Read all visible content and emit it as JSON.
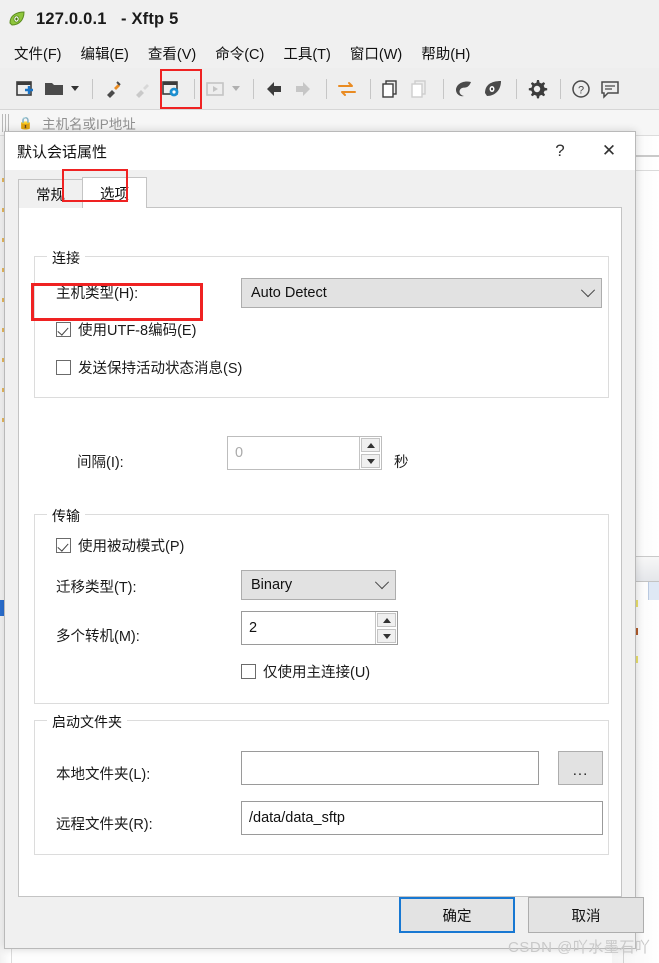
{
  "app": {
    "title": "127.0.0.1   - Xftp 5",
    "icon": "xftp-leaf-icon",
    "menu": [
      {
        "label": "文件(F)",
        "name": "menu-file"
      },
      {
        "label": "编辑(E)",
        "name": "menu-edit"
      },
      {
        "label": "查看(V)",
        "name": "menu-view"
      },
      {
        "label": "命令(C)",
        "name": "menu-command"
      },
      {
        "label": "工具(T)",
        "name": "menu-tools"
      },
      {
        "label": "窗口(W)",
        "name": "menu-window"
      },
      {
        "label": "帮助(H)",
        "name": "menu-help"
      }
    ],
    "toolbar": {
      "highlighted_button": "session-properties-icon",
      "highlight_color": "#ef2222"
    },
    "addressbar": {
      "lock_icon": "lock-icon",
      "placeholder": "主机名或IP地址"
    }
  },
  "dialog": {
    "title": "默认会话属性",
    "help_label": "?",
    "close_label": "✕",
    "tabs": [
      {
        "label": "常规",
        "name": "tab-general",
        "active": false
      },
      {
        "label": "选项",
        "name": "tab-options",
        "active": true
      }
    ],
    "active_tab_highlight_color": "#ef2222",
    "groups": {
      "connection": {
        "legend": "连接",
        "host_type_label": "主机类型(H):",
        "host_type_value": "Auto Detect",
        "utf8_label": "使用UTF-8编码(E)",
        "utf8_checked": true,
        "utf8_highlight_color": "#ef2222",
        "keepalive_label": "发送保持活动状态消息(S)",
        "keepalive_checked": false,
        "interval_label": "间隔(I):",
        "interval_value": "0",
        "interval_unit": "秒"
      },
      "transfer": {
        "legend": "传输",
        "passive_label": "使用被动模式(P)",
        "passive_checked": true,
        "transfer_type_label": "迁移类型(T):",
        "transfer_type_value": "Binary",
        "multi_label": "多个转机(M):",
        "multi_value": "2",
        "primary_only_label": "仅使用主连接(U)",
        "primary_only_checked": false
      },
      "startup": {
        "legend": "启动文件夹",
        "local_label": "本地文件夹(L):",
        "local_value": "",
        "browse_label": "...",
        "remote_label": "远程文件夹(R):",
        "remote_value": "/data/data_sftp"
      }
    },
    "buttons": {
      "ok": "确定",
      "cancel": "取消"
    }
  },
  "watermark": "CSDN @吖水墨石吖"
}
